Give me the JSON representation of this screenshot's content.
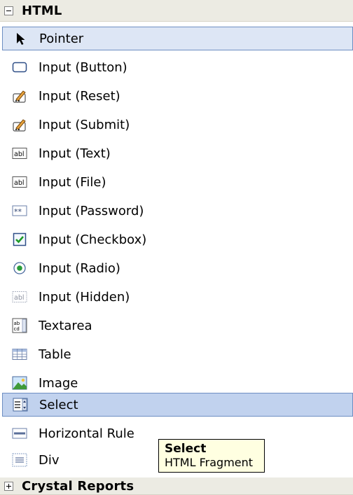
{
  "toolbox": {
    "group": {
      "title": "HTML"
    },
    "items": [
      {
        "label": "Pointer"
      },
      {
        "label": "Input (Button)"
      },
      {
        "label": "Input (Reset)"
      },
      {
        "label": "Input (Submit)"
      },
      {
        "label": "Input (Text)"
      },
      {
        "label": "Input (File)"
      },
      {
        "label": "Input (Password)"
      },
      {
        "label": "Input (Checkbox)"
      },
      {
        "label": "Input (Radio)"
      },
      {
        "label": "Input (Hidden)"
      },
      {
        "label": "Textarea"
      },
      {
        "label": "Table"
      },
      {
        "label": "Image"
      },
      {
        "label": "Select"
      },
      {
        "label": "Horizontal Rule"
      },
      {
        "label": "Div"
      }
    ],
    "next_group": {
      "title": "Crystal Reports"
    }
  },
  "tooltip": {
    "title": "Select",
    "subtitle": "HTML Fragment"
  }
}
